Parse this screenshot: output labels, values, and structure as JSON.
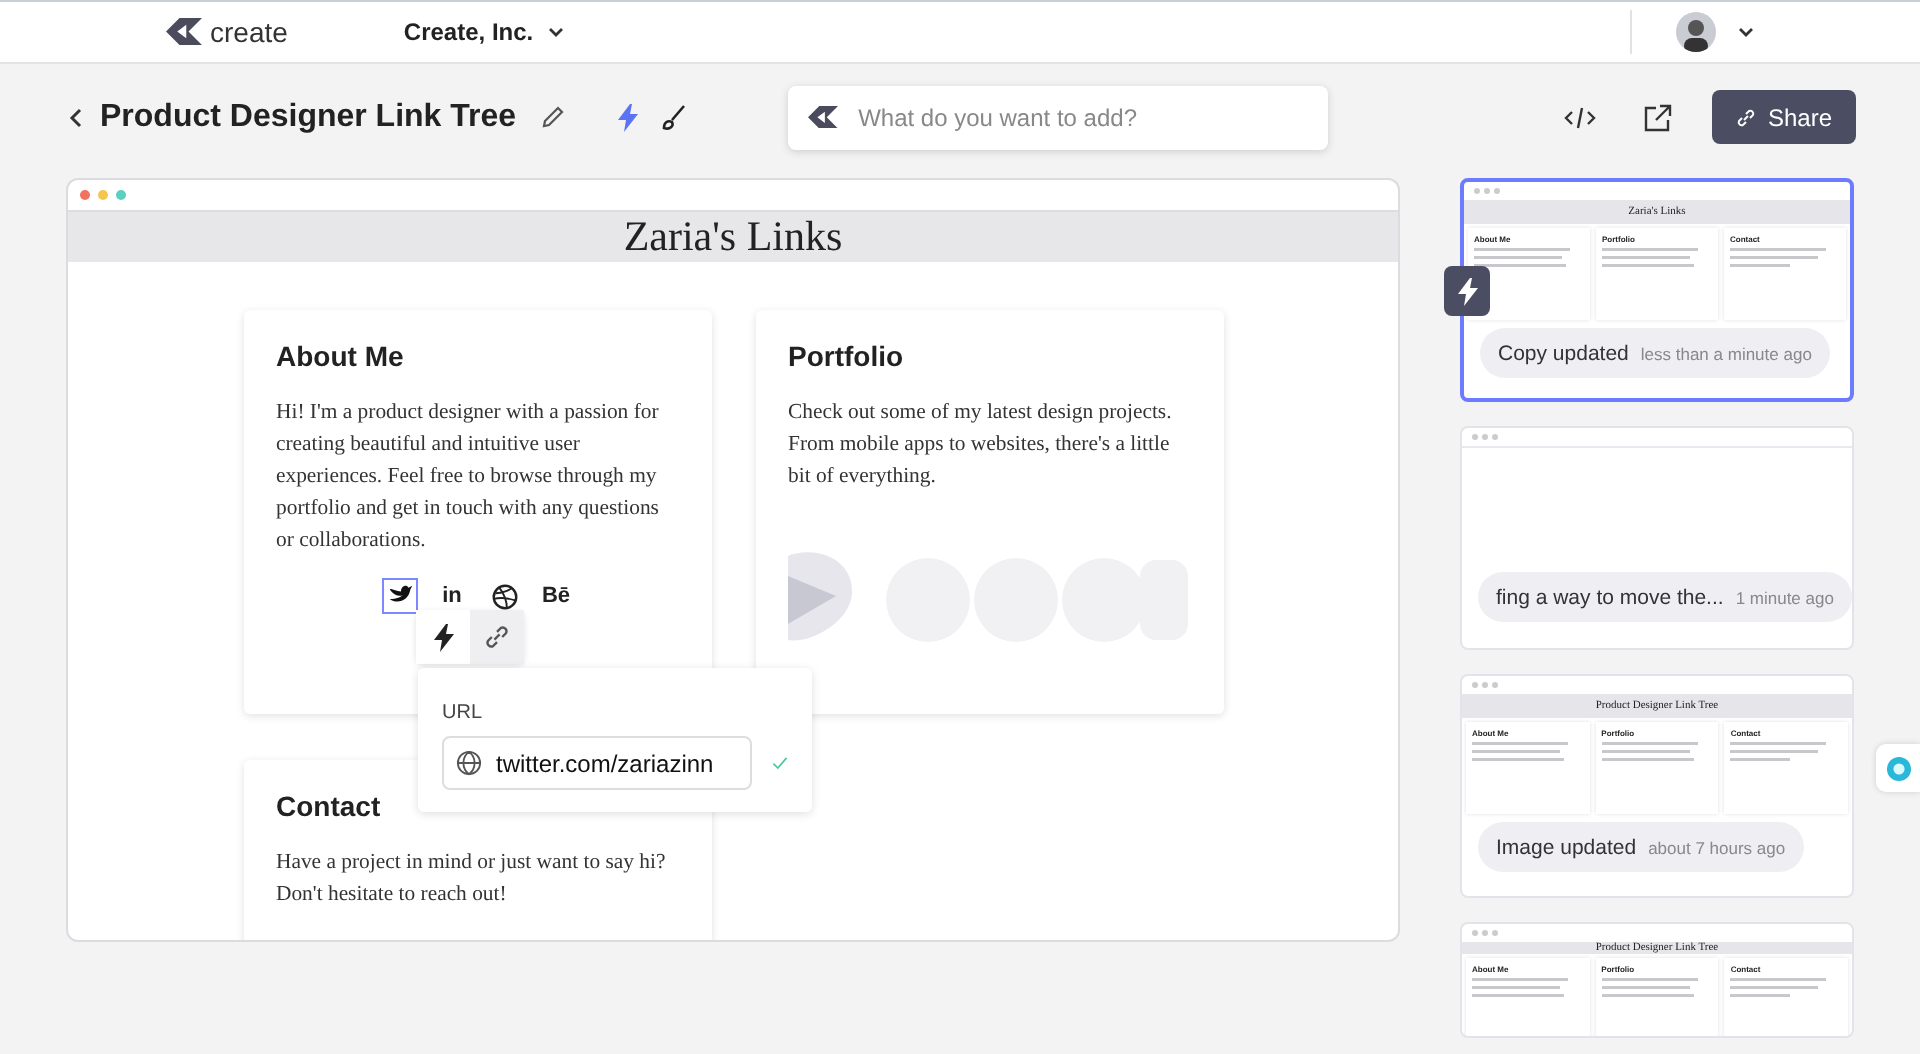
{
  "topbar": {
    "logo": "create",
    "org": "Create, Inc."
  },
  "toolbar": {
    "title": "Product Designer Link Tree",
    "prompt": {
      "placeholder": "What do you want to add?"
    },
    "share": "Share"
  },
  "preview": {
    "site_title": "Zaria's Links",
    "cards": [
      {
        "heading": "About Me",
        "body": "Hi! I'm a product designer with a passion for creating beautiful and intuitive user experiences. Feel free to browse through my portfolio and get in touch with any questions or collaborations.",
        "social": [
          {
            "kind": "bird",
            "selected": true
          },
          {
            "kind": "glyph",
            "text": "in",
            "selected": false
          },
          {
            "kind": "ball",
            "selected": false
          },
          {
            "kind": "glyph",
            "text": "Bē",
            "selected": false
          }
        ]
      },
      {
        "heading": "Portfolio",
        "body": "Check out some of my latest design projects. From mobile apps to websites, there's a little bit of everything."
      },
      {
        "heading": "Contact",
        "body": "Have a project in mind or just want to say hi? Don't hesitate to reach out!"
      }
    ],
    "url_popover": {
      "label": "URL",
      "value": "twitter.com/zariazinn"
    }
  },
  "history": [
    {
      "selected": true,
      "thumb_title": "Zaria's Links",
      "sections": [
        "About Me",
        "Portfolio",
        "Contact"
      ],
      "label": "Copy updated",
      "time": "less than a minute ago"
    },
    {
      "selected": false,
      "label": "fing a way to move the...",
      "time": "1 minute ago"
    },
    {
      "selected": false,
      "thumb_title": "Product Designer Link Tree",
      "sections": [
        "About Me",
        "Portfolio",
        "Contact"
      ],
      "label": "Image updated",
      "time": "about 7 hours ago"
    },
    {
      "selected": false,
      "thumb_title": "Product Designer Link Tree",
      "sections": [
        "About Me",
        "Portfolio",
        "Contact"
      ]
    }
  ]
}
